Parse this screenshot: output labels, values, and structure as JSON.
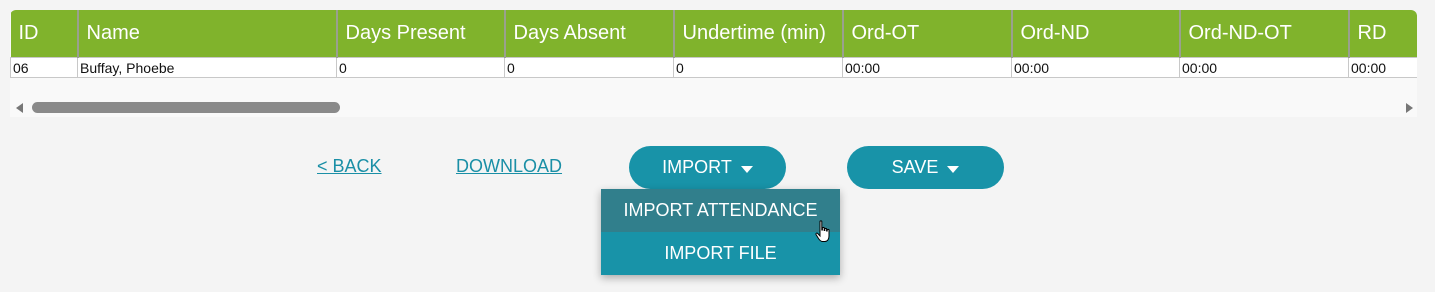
{
  "table": {
    "columns": [
      "ID",
      "Name",
      "Days Present",
      "Days Absent",
      "Undertime (min)",
      "Ord-OT",
      "Ord-ND",
      "Ord-ND-OT",
      "RD"
    ],
    "rows": [
      [
        "06",
        "Buffay, Phoebe",
        "0",
        "0",
        "0",
        "00:00",
        "00:00",
        "00:00",
        "00:00"
      ]
    ]
  },
  "actions": {
    "back": "< BACK",
    "download": "DOWNLOAD",
    "import": "IMPORT",
    "save": "SAVE"
  },
  "import_menu": {
    "items": [
      "IMPORT ATTENDANCE",
      "IMPORT FILE"
    ],
    "hovered": "IMPORT ATTENDANCE"
  },
  "colors": {
    "header_bg": "#80b32c",
    "button_bg": "#1893a8",
    "menu_hover_bg": "#317f8c",
    "link": "#1a8fa6"
  }
}
